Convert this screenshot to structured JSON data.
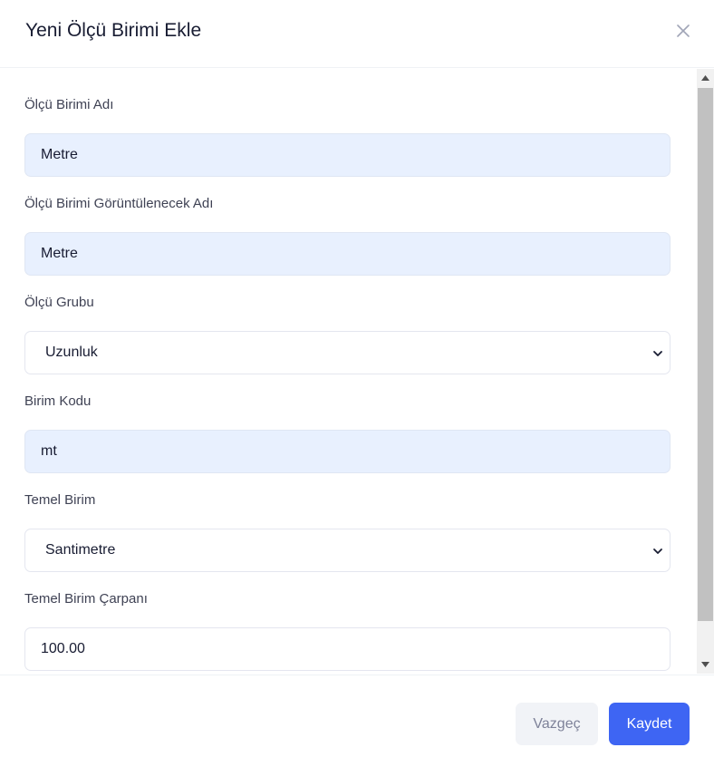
{
  "modal": {
    "title": "Yeni Ölçü Birimi Ekle",
    "close_icon": "close-icon"
  },
  "form": {
    "unit_name": {
      "label": "Ölçü Birimi Adı",
      "value": "Metre"
    },
    "display_name": {
      "label": "Ölçü Birimi Görüntülenecek Adı",
      "value": "Metre"
    },
    "unit_group": {
      "label": "Ölçü Grubu",
      "selected": "Uzunluk"
    },
    "unit_code": {
      "label": "Birim Kodu",
      "value": "mt"
    },
    "base_unit": {
      "label": "Temel Birim",
      "selected": "Santimetre"
    },
    "base_multiplier": {
      "label": "Temel Birim Çarpanı",
      "value": "100.00"
    }
  },
  "footer": {
    "cancel_label": "Vazgeç",
    "save_label": "Kaydet"
  },
  "colors": {
    "primary": "#3e65f3",
    "filled_input_bg": "#e8f0fe",
    "cancel_bg": "#f1f3f7"
  }
}
